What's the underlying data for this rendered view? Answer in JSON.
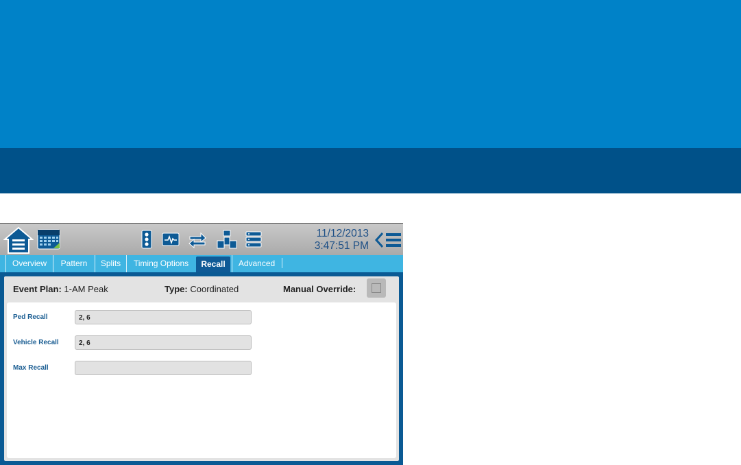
{
  "datetime": {
    "date": "11/12/2013",
    "time": "3:47:51 PM"
  },
  "toolbar_icons": [
    "home-icon",
    "calendar-icon",
    "traffic-signal-icon",
    "waveform-icon",
    "swap-arrows-icon",
    "network-icon",
    "list-icon",
    "back-chevron-icon",
    "menu-icon"
  ],
  "tabs": [
    {
      "label": "Overview"
    },
    {
      "label": "Pattern"
    },
    {
      "label": "Splits"
    },
    {
      "label": "Timing Options"
    },
    {
      "label": "Recall",
      "active": true
    },
    {
      "label": "Advanced"
    }
  ],
  "header": {
    "event_plan_label": "Event Plan:",
    "event_plan_value": "1-AM Peak",
    "type_label": "Type:",
    "type_value": "Coordinated",
    "manual_override_label": "Manual Override:"
  },
  "fields": [
    {
      "label": "Ped Recall",
      "value": "2, 6"
    },
    {
      "label": "Vehicle Recall",
      "value": "2, 6"
    },
    {
      "label": "Max Recall",
      "value": ""
    }
  ],
  "colors": {
    "banner": "#0082c8",
    "banner_dark": "#005189",
    "tab_bar": "#3fb5e2",
    "active_tab": "#0e5a96",
    "label": "#1a5d92"
  }
}
